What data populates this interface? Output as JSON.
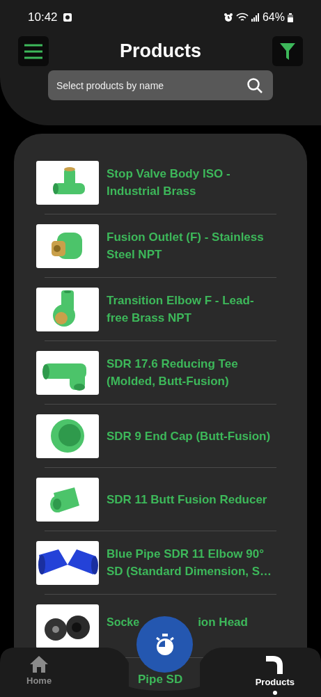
{
  "status_bar": {
    "time": "10:42",
    "battery": "64%"
  },
  "header": {
    "title": "Products"
  },
  "search": {
    "placeholder": "Select products by name"
  },
  "products": [
    {
      "kind": "row",
      "name": "Stop Valve Body ISO - Industrial Brass"
    },
    {
      "kind": "row",
      "name": "Fusion Outlet (F) - Stainless Steel NPT"
    },
    {
      "kind": "row",
      "name": "Transition Elbow F - Lead-free Brass NPT"
    },
    {
      "kind": "row",
      "name": "SDR 17.6 Reducing Tee (Molded, Butt-Fusion)"
    },
    {
      "kind": "row",
      "name": "SDR 9 End Cap (Butt-Fusion)"
    },
    {
      "kind": "row",
      "name": "SDR 11 Butt Fusion Reducer"
    },
    {
      "kind": "row",
      "name": "Blue Pipe SDR 11 Elbow 90° SD (Standard Dimension, S…"
    },
    {
      "kind": "split",
      "name": "Socke",
      "name_after_cover": "ion Head"
    },
    {
      "kind": "peek",
      "name": "Pipe SD"
    }
  ],
  "nav": [
    {
      "label": "Home",
      "selected": false
    },
    {
      "label": "Products",
      "selected": true
    }
  ]
}
